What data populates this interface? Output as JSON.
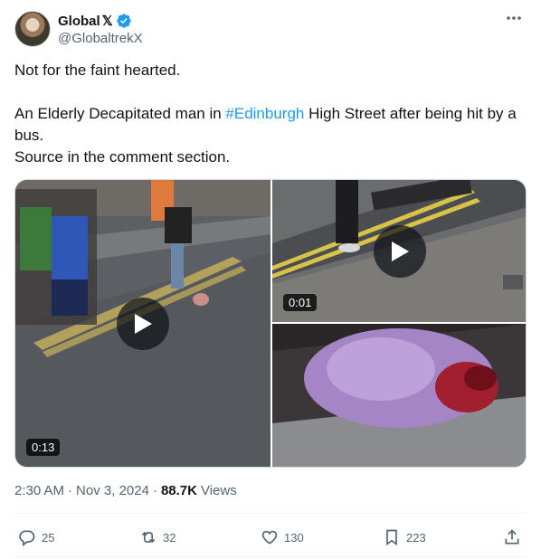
{
  "author": {
    "display_name": "Global",
    "x_badge": "𝕏",
    "handle": "@GlobaltrekX",
    "verified": true,
    "avatar_icon": "avatar-portrait"
  },
  "post": {
    "line1": "Not for the faint hearted.",
    "line2_before": "An Elderly Decapitated man in ",
    "hashtag": "#Edinburgh",
    "line2_after": "  High Street after being hit by a bus.",
    "line3": "Source in the comment section."
  },
  "media": {
    "video_left_duration": "0:13",
    "video_top_right_duration": "0:01",
    "play_icon": "play-icon"
  },
  "meta": {
    "time": "2:30 AM",
    "sep1": "·",
    "date": "Nov 3, 2024",
    "sep2": "·",
    "views_count": "88.7K",
    "views_label": "Views"
  },
  "actions": {
    "replies": "25",
    "reposts": "32",
    "likes": "130",
    "bookmarks": "223"
  },
  "colors": {
    "accent": "#1d9bf0",
    "secondary_text": "#536471",
    "border": "#cfd9de"
  }
}
